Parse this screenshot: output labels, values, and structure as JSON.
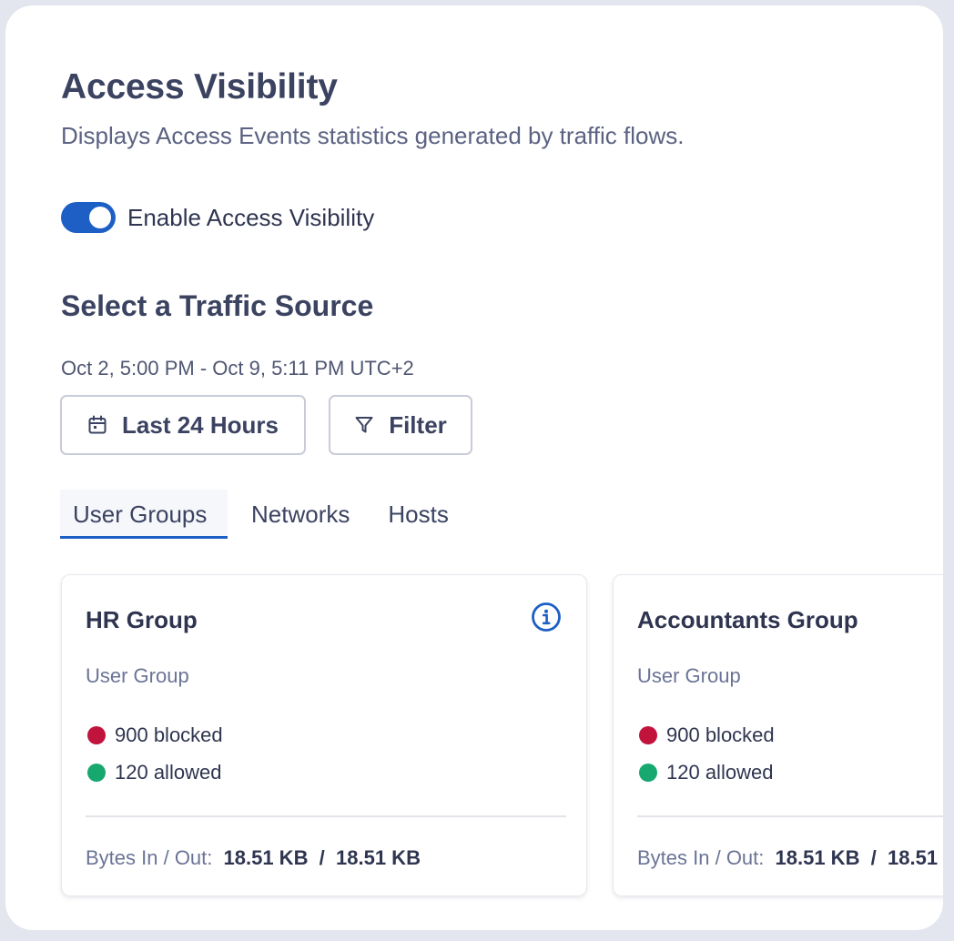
{
  "header": {
    "title": "Access Visibility",
    "description": "Displays Access Events statistics generated by traffic flows."
  },
  "toggle": {
    "label": "Enable Access Visibility",
    "enabled": true,
    "color": "#1d5fc4"
  },
  "traffic": {
    "title": "Select a Traffic Source",
    "date_range": "Oct 2, 5:00 PM - Oct 9, 5:11 PM UTC+2",
    "time_button": {
      "label": "Last 24 Hours",
      "icon": "calendar-icon"
    },
    "filter_button": {
      "label": "Filter",
      "icon": "filter-icon"
    }
  },
  "tabs": [
    {
      "label": "User Groups",
      "active": true
    },
    {
      "label": "Networks",
      "active": false
    },
    {
      "label": "Hosts",
      "active": false
    }
  ],
  "cards": [
    {
      "name": "HR Group",
      "type": "User Group",
      "blocked": "900 blocked",
      "allowed": "120 allowed",
      "bytes_label": "Bytes In / Out:",
      "bytes_value": "18.51 KB  /  18.51 KB",
      "icon": "info-icon"
    },
    {
      "name": "Accountants Group",
      "type": "User Group",
      "blocked": "900 blocked",
      "allowed": "120 allowed",
      "bytes_label": "Bytes In / Out:",
      "bytes_value": "18.51 KB  /  18.51"
    }
  ],
  "colors": {
    "accent": "#1d5fc4",
    "blocked": "#c0143c",
    "allowed": "#17a870",
    "heading": "#3b4361"
  }
}
